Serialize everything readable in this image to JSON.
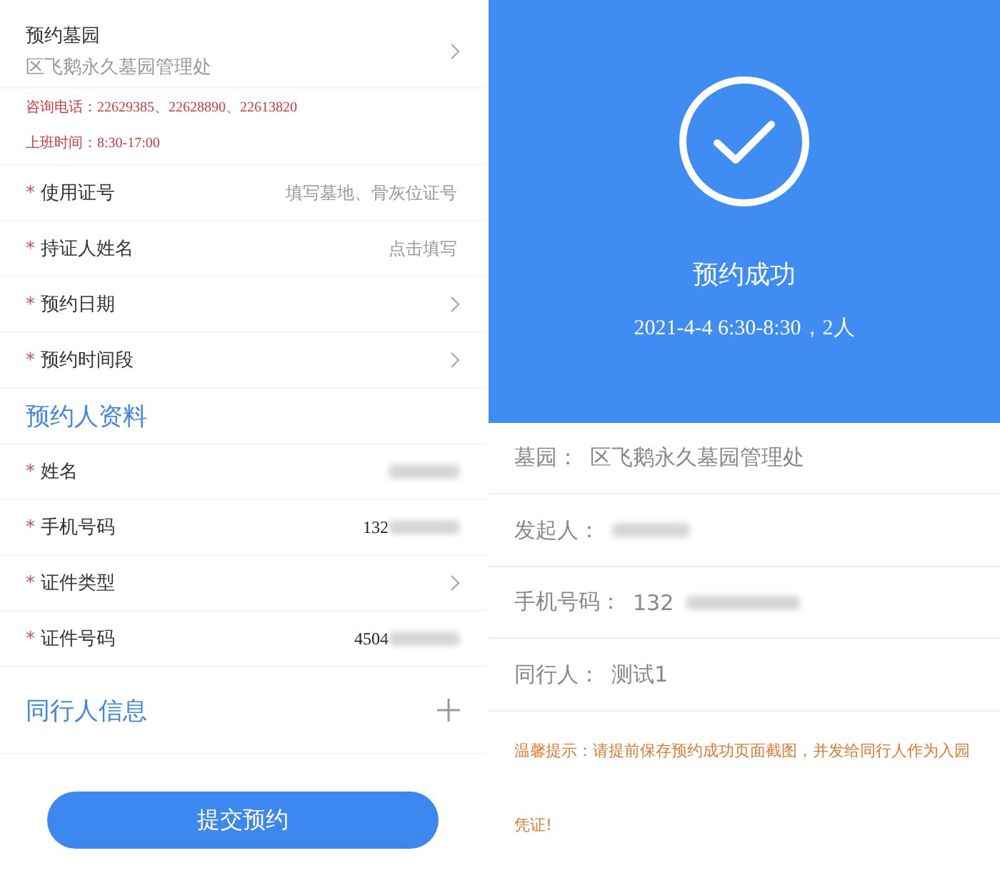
{
  "form": {
    "required_mark": "*",
    "cemetery": {
      "label": "预约墓园",
      "value": "区飞鹅永久墓园管理处"
    },
    "notices": [
      "咨询电话：22629385、22628890、22613820",
      "上班时间：8:30-17:00"
    ],
    "fields": [
      {
        "kind": "input",
        "label": "使用证号",
        "placeholder": "填写墓地、骨灰位证号"
      },
      {
        "kind": "input",
        "label": "持证人姓名",
        "placeholder": "点击填写"
      },
      {
        "kind": "select",
        "label": "预约日期"
      },
      {
        "kind": "select",
        "label": "预约时间段"
      }
    ],
    "applicant_title": "预约人资料",
    "applicant_fields": [
      {
        "kind": "redacted",
        "label": "姓名"
      },
      {
        "kind": "value",
        "label": "手机号码",
        "value": "132"
      },
      {
        "kind": "select",
        "label": "证件类型"
      },
      {
        "kind": "value",
        "label": "证件号码",
        "value": "4504"
      }
    ],
    "companions_title": "同行人信息",
    "submit": "提交预约"
  },
  "result": {
    "title": "预约成功",
    "subtitle": "2021-4-4 6:30-8:30，2人",
    "rows": [
      {
        "kind": "value",
        "label": "墓园：",
        "value": "区飞鹅永久墓园管理处"
      },
      {
        "kind": "redacted",
        "label": "发起人："
      },
      {
        "kind": "value",
        "label": "手机号码：",
        "value": "132"
      },
      {
        "kind": "value",
        "label": "同行人：",
        "value": "测试1"
      }
    ],
    "tip": "温馨提示：请提前保存预约成功页面截图，并发给同行人作为入园凭证!"
  }
}
